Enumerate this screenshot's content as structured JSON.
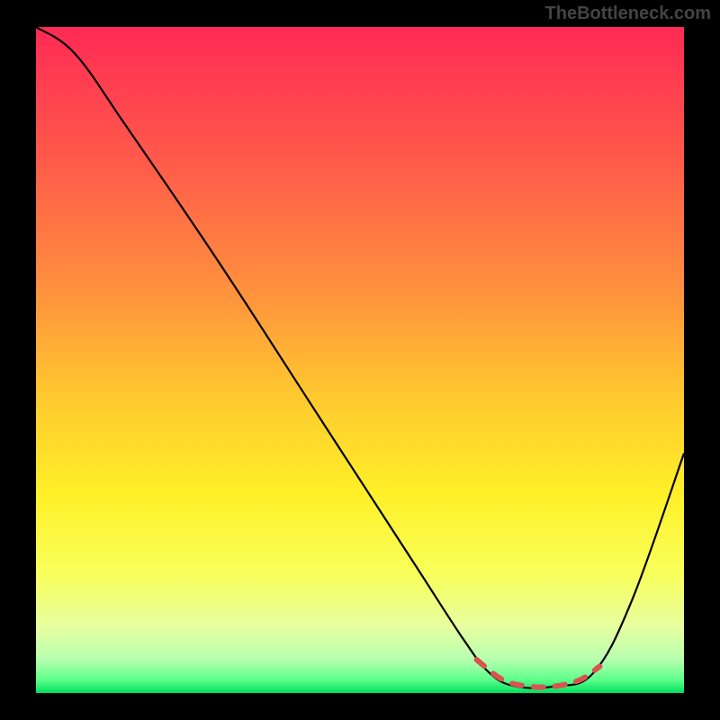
{
  "watermark": "TheBottleneck.com",
  "chart_data": {
    "type": "line",
    "title": "",
    "xlabel": "",
    "ylabel": "",
    "xlim": [
      0,
      100
    ],
    "ylim": [
      0,
      100
    ],
    "gradient": {
      "type": "vertical",
      "stops": [
        {
          "pos": 0.0,
          "color": "#ff2a55"
        },
        {
          "pos": 0.2,
          "color": "#ff5a4a"
        },
        {
          "pos": 0.4,
          "color": "#ff923d"
        },
        {
          "pos": 0.55,
          "color": "#ffc72f"
        },
        {
          "pos": 0.7,
          "color": "#fff028"
        },
        {
          "pos": 0.82,
          "color": "#f8ff5a"
        },
        {
          "pos": 0.9,
          "color": "#e7ffa0"
        },
        {
          "pos": 0.95,
          "color": "#b7ffb0"
        },
        {
          "pos": 0.98,
          "color": "#5dff8a"
        },
        {
          "pos": 1.0,
          "color": "#00e060"
        }
      ]
    },
    "series": [
      {
        "name": "bottleneck-curve",
        "color": "#000000",
        "points": [
          {
            "x": 0,
            "y": 100
          },
          {
            "x": 6,
            "y": 96
          },
          {
            "x": 14,
            "y": 85
          },
          {
            "x": 28,
            "y": 65
          },
          {
            "x": 44,
            "y": 41
          },
          {
            "x": 58,
            "y": 20
          },
          {
            "x": 66,
            "y": 8
          },
          {
            "x": 70,
            "y": 3
          },
          {
            "x": 74,
            "y": 1
          },
          {
            "x": 80,
            "y": 1
          },
          {
            "x": 86,
            "y": 3
          },
          {
            "x": 92,
            "y": 14
          },
          {
            "x": 100,
            "y": 36
          }
        ]
      }
    ],
    "optimal_zone": {
      "name": "optimal-range-dashes",
      "color": "#d9534f",
      "points": [
        {
          "x": 68,
          "y": 5
        },
        {
          "x": 72,
          "y": 2
        },
        {
          "x": 76,
          "y": 1
        },
        {
          "x": 80,
          "y": 1
        },
        {
          "x": 84,
          "y": 2
        },
        {
          "x": 87,
          "y": 4
        }
      ]
    }
  }
}
